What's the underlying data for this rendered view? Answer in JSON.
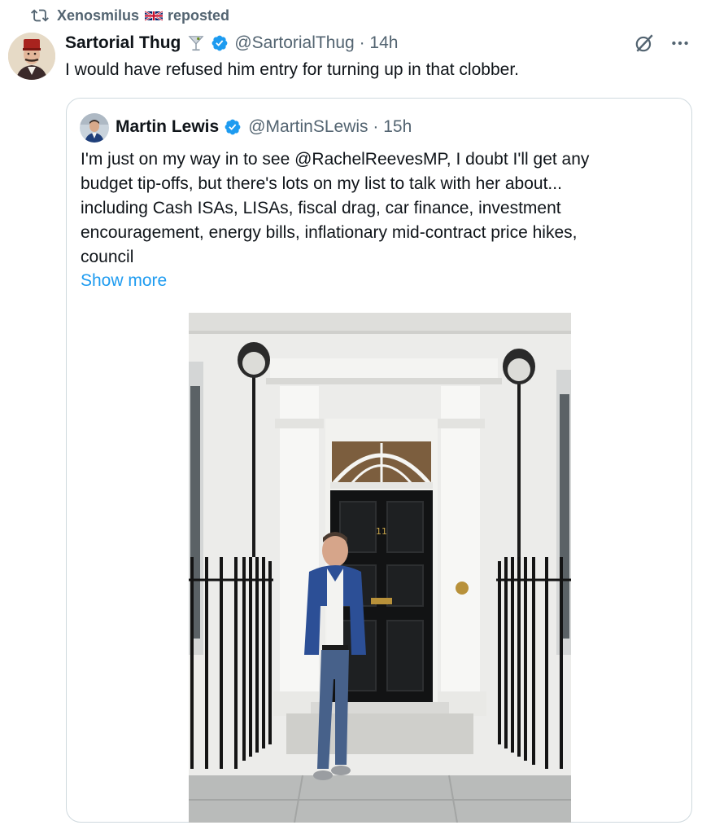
{
  "repost": {
    "user": "Xenosmilus",
    "label": "reposted",
    "icon": "repost-icon",
    "flag_icon": "uk-flag-icon"
  },
  "post": {
    "display_name": "Sartorial Thug",
    "name_emoji_icon": "cocktail-glass-icon",
    "handle_time": "@SartorialThug · 14h",
    "text": "I would have refused him entry for turning up in that clobber.",
    "action_icons": [
      "grok-icon",
      "more-icon"
    ]
  },
  "quote": {
    "display_name": "Martin Lewis",
    "handle_time": "@MartinSLewis · 15h",
    "text_lines": [
      "I'm just on my way in to see @RachelReevesMP, I doubt I'll get any",
      "budget tip-offs, but there's lots on my list to talk with her about...",
      "including Cash ISAs, LISAs, fiscal drag, car finance, investment",
      "encouragement, energy bills, inflationary mid-contract price hikes,",
      "council"
    ],
    "show_more": "Show more",
    "door_number": "11"
  },
  "colors": {
    "text": "#0f1419",
    "secondary": "#536471",
    "link": "#1d9bf0",
    "verified": "#1d9bf0",
    "border": "#cfd9de"
  }
}
